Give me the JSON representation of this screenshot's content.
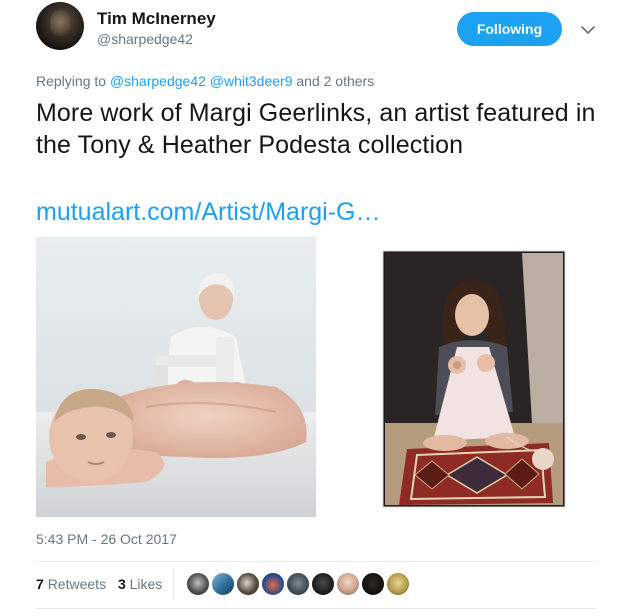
{
  "author": {
    "name": "Tim McInerney",
    "handle": "@sharpedge42"
  },
  "follow_button_label": "Following",
  "reply_context": {
    "prefix": "Replying to",
    "mention1": "@sharpedge42",
    "mention2": "@whit3deer9",
    "suffix": "and 2 others"
  },
  "tweet": {
    "text": "More work of Margi Geerlinks, an artist featured in the Tony & Heather Podesta collection",
    "link": "mutualart.com/Artist/Margi-G…"
  },
  "timestamp": "5:43 PM - 26 Oct 2017",
  "stats": {
    "retweets_count": "7",
    "retweets_label": "Retweets",
    "likes_count": "3",
    "likes_label": "Likes"
  },
  "colors": {
    "accent": "#1da1f2",
    "muted": "#657786",
    "text": "#14171a"
  },
  "icons": {
    "caret": "chevron-down-icon"
  }
}
